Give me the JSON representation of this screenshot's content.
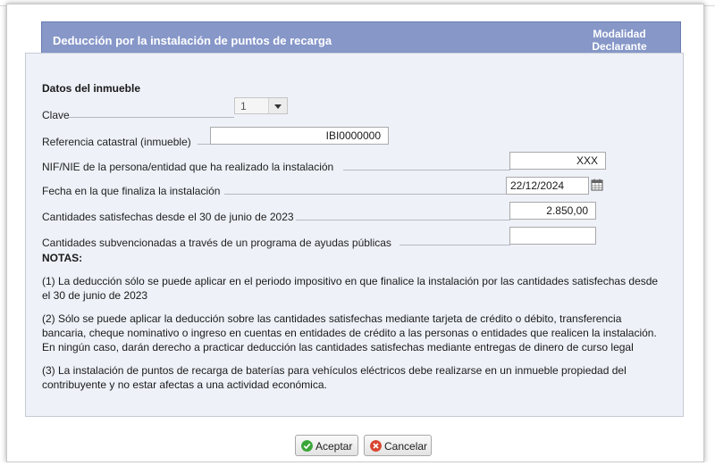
{
  "dialog": {
    "title": "Deducción por la instalación de puntos de recarga",
    "mode_line1": "Modalidad",
    "mode_line2": "Declarante"
  },
  "form": {
    "section_title": "Datos del inmueble",
    "clave_label": "Clave",
    "clave_value": "1",
    "referencia_label": "Referencia catastral (inmueble)",
    "referencia_value": "IBI0000000",
    "nif_label": "NIF/NIE de la persona/entidad que ha realizado la instalación",
    "nif_value": "XXX",
    "fecha_label": "Fecha en la que finaliza la instalación",
    "fecha_value": "22/12/2024",
    "cantidades_label": "Cantidades satisfechas desde el 30 de junio de 2023",
    "cantidades_value": "2.850,00",
    "subvencionadas_label": "Cantidades subvencionadas a través de un programa de ayudas públicas",
    "subvencionadas_value": ""
  },
  "notes": {
    "title": "NOTAS:",
    "n1_line1": "(1) La deducción sólo se puede aplicar en el periodo impositivo en que finalice la instalación por las cantidades satisfechas desde",
    "n1_line2": "el 30 de junio de 2023",
    "n2_line1": "(2) Sólo se puede aplicar la deducción sobre las cantidades satisfechas mediante tarjeta de crédito o débito, transferencia",
    "n2_line2": "bancaria, cheque nominativo o ingreso en cuentas en entidades de crédito a las personas o entidades que realicen la instalación.",
    "n2_line3": "En ningún caso, darán derecho a practicar deducción las cantidades satisfechas mediante entregas de dinero de curso legal",
    "n3_line1": "(3) La instalación de puntos de recarga de baterías para vehículos eléctricos debe realizarse en un inmueble propiedad del",
    "n3_line2": "contribuyente y no estar afectas a una actividad económica."
  },
  "buttons": {
    "accept": "Aceptar",
    "cancel": "Cancelar"
  },
  "icons": {
    "accept": "check-circle-icon",
    "cancel": "cancel-circle-icon",
    "calendar": "calendar-icon",
    "dropdown": "chevron-down-icon"
  },
  "colors": {
    "header_bg": "#8697c8",
    "panel_bg": "#eef1f8",
    "accept_icon": "#3aa63a",
    "cancel_icon": "#d8452f"
  }
}
